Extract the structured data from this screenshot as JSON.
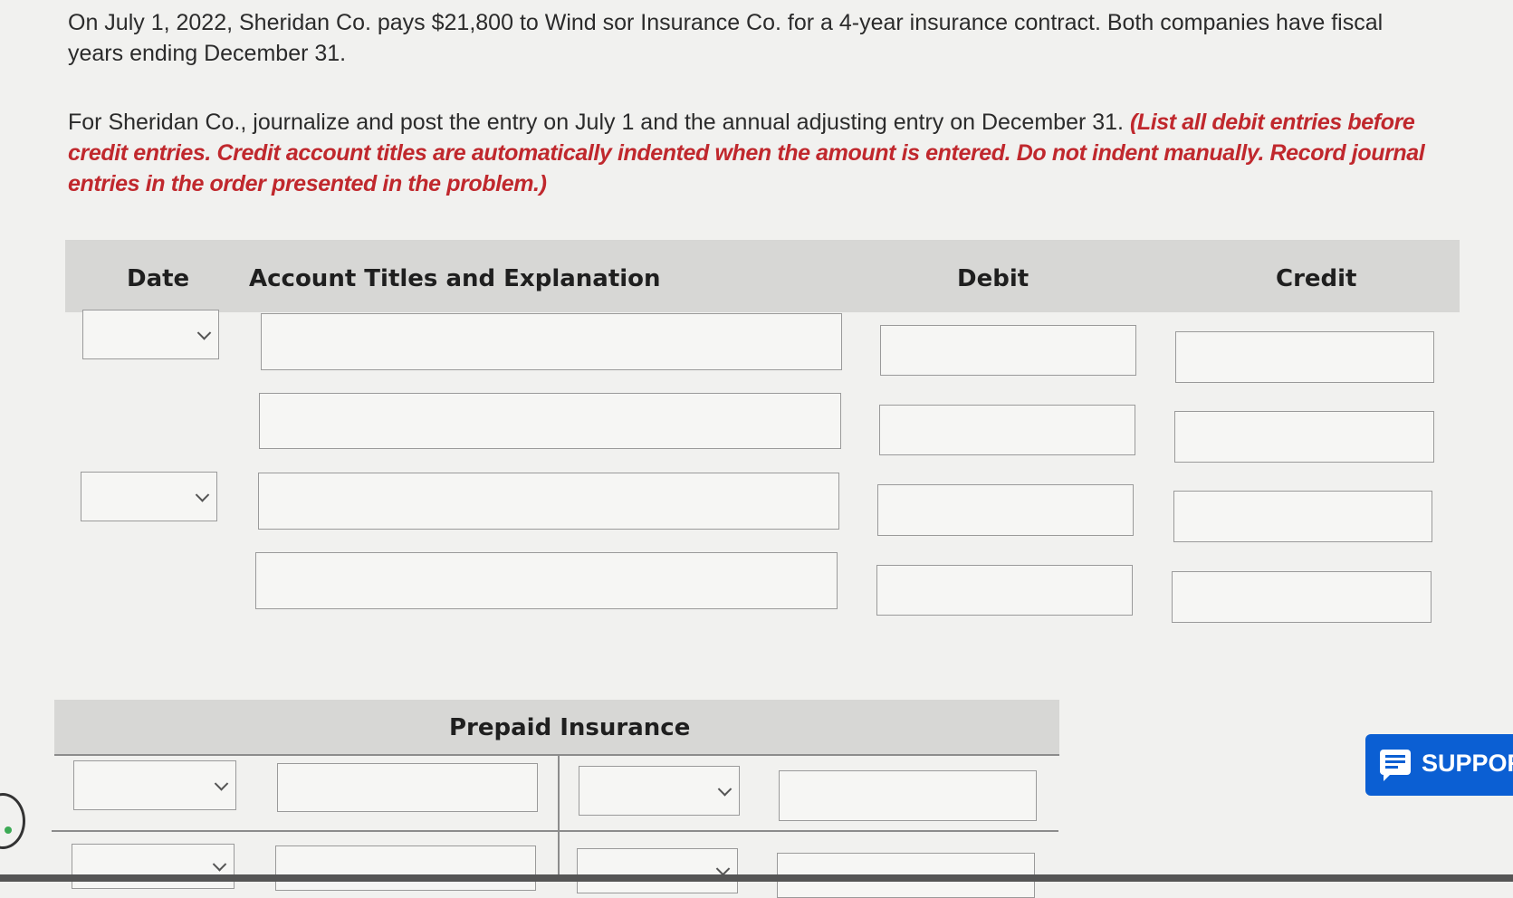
{
  "problem": {
    "text1": "On July 1, 2022, Sheridan Co. pays $21,800 to Wind sor Insurance Co. for a 4-year insurance contract. Both companies have fiscal years ending December 31.",
    "text2": "For Sheridan Co., journalize and post the entry on July 1 and the annual adjusting entry on December 31.",
    "instruction": "(List all debit entries before credit entries. Credit account titles are automatically indented when the amount is entered. Do not indent manually. Record journal entries in the order presented in the problem.)"
  },
  "journal": {
    "headers": {
      "date": "Date",
      "account": "Account Titles and Explanation",
      "debit": "Debit",
      "credit": "Credit"
    },
    "rows": [
      {
        "date": "",
        "account": "",
        "debit": "",
        "credit": ""
      },
      {
        "account": "",
        "debit": "",
        "credit": ""
      },
      {
        "date": "",
        "account": "",
        "debit": "",
        "credit": ""
      },
      {
        "account": "",
        "debit": "",
        "credit": ""
      }
    ]
  },
  "ledger": {
    "title": "Prepaid Insurance",
    "rows": [
      {
        "left_date": "",
        "left_amount": "",
        "right_date": "",
        "right_amount": ""
      },
      {
        "left_date": "",
        "left_amount": "",
        "right_date": "",
        "right_amount": ""
      }
    ]
  },
  "support": {
    "label": "SUPPOR",
    "icon": "chat-icon",
    "color": "#0b5fd3"
  },
  "colors": {
    "instruction": "#c0282d",
    "header_bg": "#d7d7d5"
  }
}
